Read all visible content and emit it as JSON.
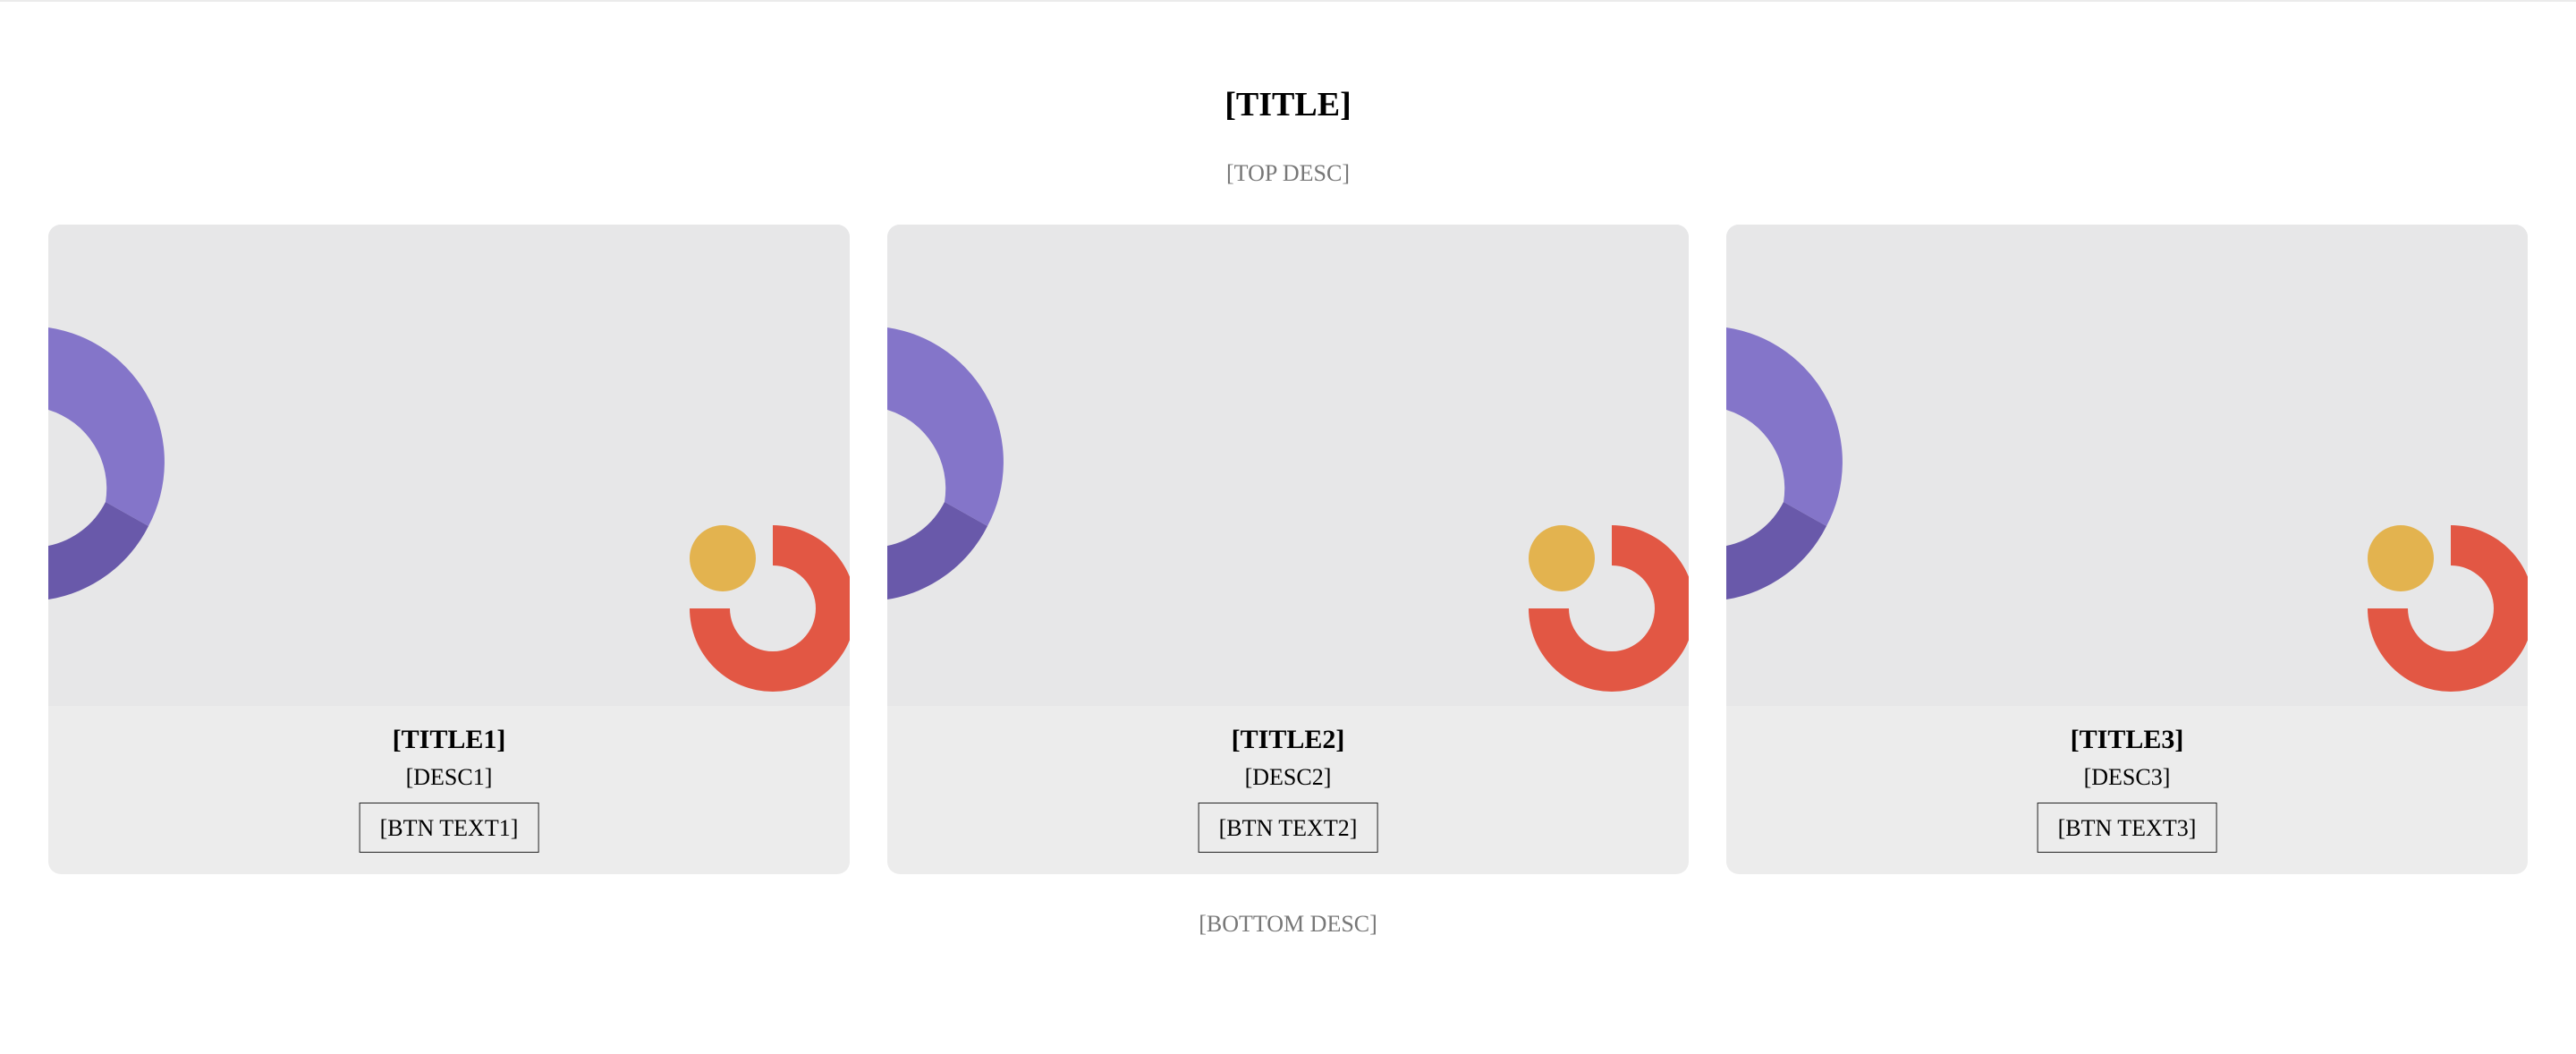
{
  "header": {
    "title": "[TITLE]",
    "top_desc": "[TOP DESC]"
  },
  "cards": [
    {
      "title": "[TITLE1]",
      "desc": "[DESC1]",
      "button": "[BTN TEXT1]"
    },
    {
      "title": "[TITLE2]",
      "desc": "[DESC2]",
      "button": "[BTN TEXT2]"
    },
    {
      "title": "[TITLE3]",
      "desc": "[DESC3]",
      "button": "[BTN TEXT3]"
    }
  ],
  "footer": {
    "bottom_desc": "[BOTTOM DESC]"
  },
  "colors": {
    "purple_light": "#8475c9",
    "purple_dark": "#6959aa",
    "gold": "#e3b34f",
    "red": "#e25744",
    "card_bg": "#ececec",
    "illustration_bg": "#e7e7e8",
    "muted_text": "#777777"
  }
}
